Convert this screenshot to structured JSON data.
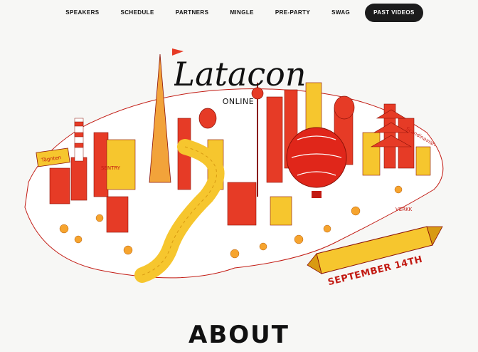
{
  "nav": {
    "items": [
      "SPEAKERS",
      "SCHEDULE",
      "PARTNERS",
      "MINGLE",
      "PRE-PARTY",
      "SWAG"
    ],
    "active_item": "PAST VIDEOS"
  },
  "hero": {
    "logo_text": "Latacon",
    "logo_subtitle": "ONLINE",
    "banner_text": "SEPTEMBER 14TH",
    "sign_left": "Tägnten",
    "sign_sentry": "SENTRY",
    "sign_verkk": "VERKK",
    "sign_right": "Scandinavian"
  },
  "about": {
    "heading": "ABOUT"
  },
  "colors": {
    "accent_red": "#d8271b",
    "accent_yellow": "#f6c62e",
    "nav_active_bg": "#1c1c1c",
    "background": "#f7f7f5"
  }
}
